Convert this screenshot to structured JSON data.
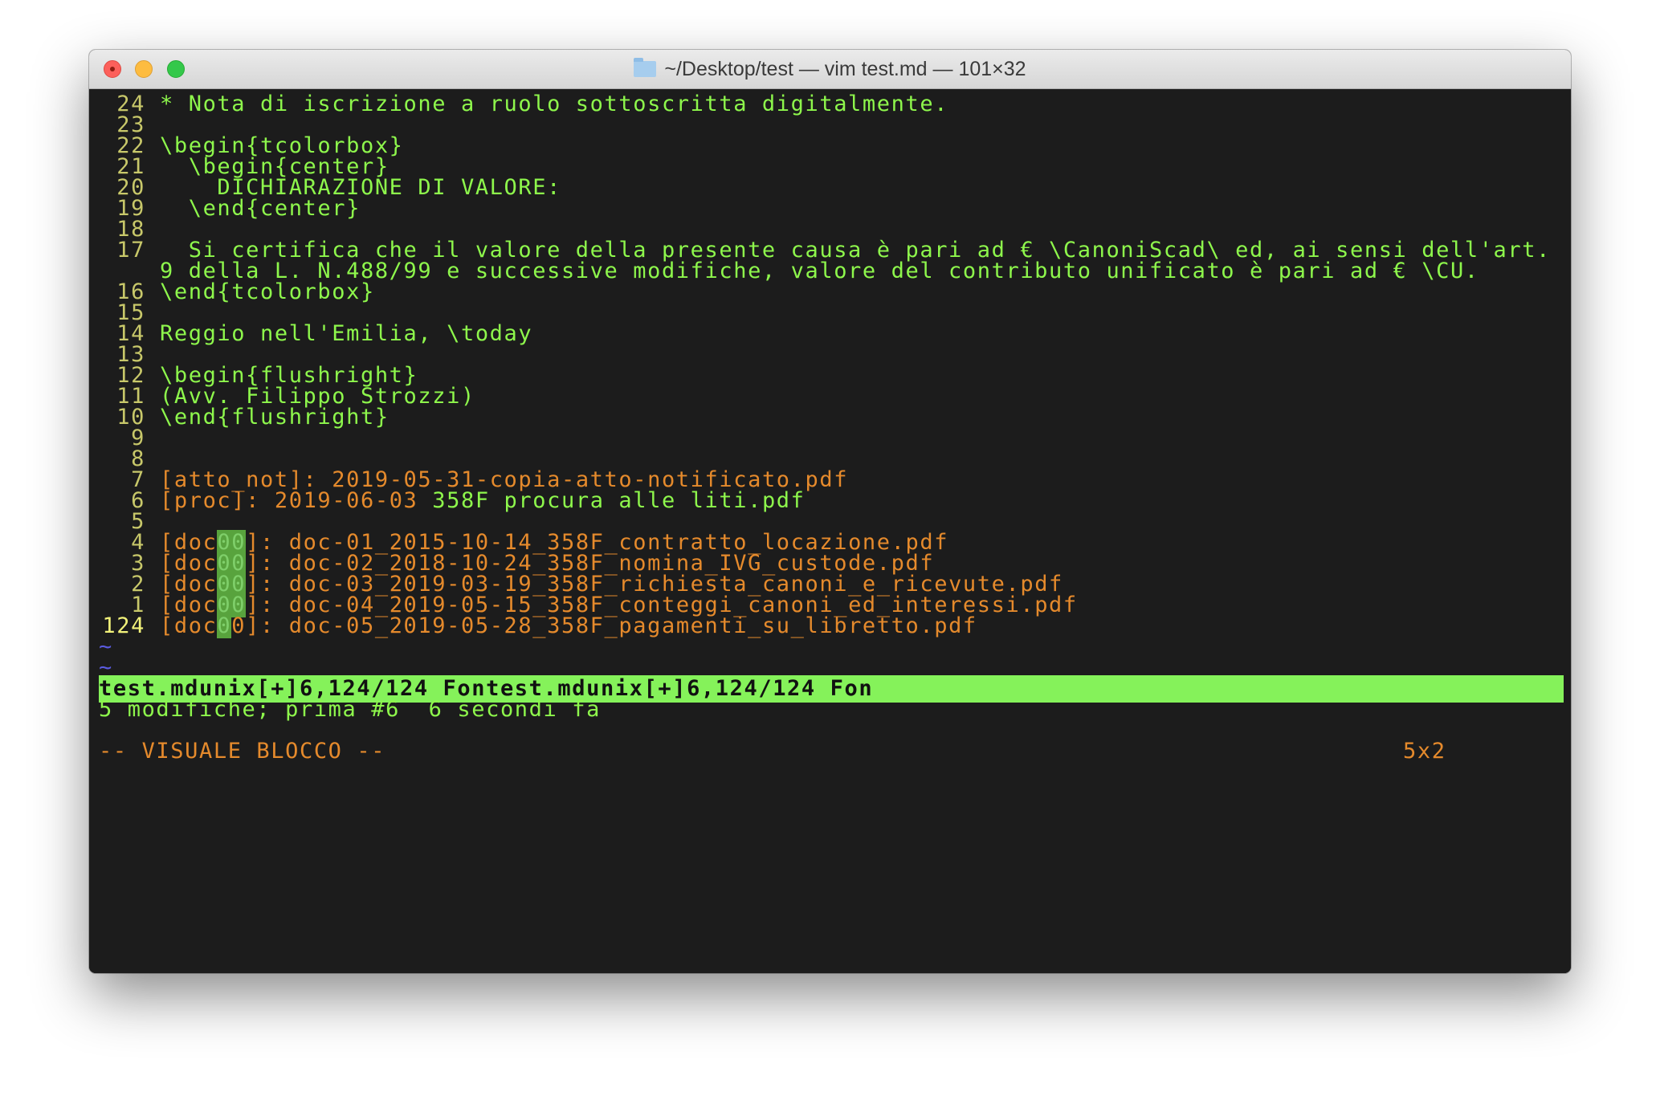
{
  "window": {
    "title": "~/Desktop/test — vim test.md — 101×32"
  },
  "editor": {
    "lines": {
      "l24": {
        "num": "24",
        "text": "* Nota di iscrizione a ruolo sottoscritta digitalmente."
      },
      "l23": {
        "num": "23"
      },
      "l22": {
        "num": "22",
        "text": "\\begin{tcolorbox}"
      },
      "l21": {
        "num": "21",
        "text": "  \\begin{center}"
      },
      "l20": {
        "num": "20",
        "text": "    DICHIARAZIONE DI VALORE:"
      },
      "l19": {
        "num": "19",
        "text": "  \\end{center}"
      },
      "l18": {
        "num": "18"
      },
      "l17": {
        "num": "17",
        "text": "  Si certifica che il valore della presente causa è pari ad € \\CanoniScad\\ ed, ai sensi dell'art."
      },
      "l17b": {
        "text": "9 della L. N.488/99 e successive modifiche, valore del contributo unificato è pari ad € \\CU."
      },
      "l16": {
        "num": "16",
        "text": "\\end{tcolorbox}"
      },
      "l15": {
        "num": "15"
      },
      "l14": {
        "num": "14",
        "text": "Reggio nell'Emilia, \\today"
      },
      "l13": {
        "num": "13"
      },
      "l12": {
        "num": "12",
        "text": "\\begin{flushright}"
      },
      "l11": {
        "num": "11",
        "text": "(Avv. Filippo Strozzi)"
      },
      "l10": {
        "num": "10",
        "text": "\\end{flushright}"
      },
      "l9": {
        "num": "9"
      },
      "l8": {
        "num": "8"
      },
      "l7": {
        "num": "7",
        "ref": "[atto_not]:",
        "value": "2019-05-31-copia-atto-notificato.pdf"
      },
      "l6": {
        "num": "6",
        "ref": "[proc]:",
        "date": "2019-06-03",
        "rest": "358F procura alle liti.pdf"
      },
      "l5": {
        "num": "5"
      },
      "l4": {
        "num": "4",
        "value": "doc-01_2015-10-14_358F_contratto_locazione.pdf"
      },
      "l3": {
        "num": "3",
        "value": "doc-02_2018-10-24_358F_nomina_IVG_custode.pdf"
      },
      "l2": {
        "num": "2",
        "value": "doc-03_2019-03-19_358F_richiesta_canoni_e_ricevute.pdf"
      },
      "l1": {
        "num": "1",
        "value": "doc-04_2019-05-15_358F_conteggi_canoni_ed_interessi.pdf"
      },
      "l124": {
        "num": "124",
        "value": "doc-05_2019-05-28_358F_pagamenti_su_libretto.pdf"
      }
    },
    "doc_ref": {
      "open": "[doc",
      "selected": "00",
      "cursor_selected": "0",
      "cursor_char": "0",
      "close": "]:"
    },
    "tilde": "~"
  },
  "statusline": {
    "text": "test.mdunix[+]6,124/124 Fontest.mdunix[+]6,124/124 Fon"
  },
  "message": {
    "text": "5 modifiche; prima #6  6 secondi fa"
  },
  "mode": {
    "label": "-- VISUALE BLOCCO --",
    "selection_size": "5x2"
  },
  "colors": {
    "background": "#1c1c1c",
    "text_green": "#8ef74c",
    "link_orange": "#e58a2c",
    "line_number": "#c8c86a",
    "statusline": "#85f25a",
    "visual_selection": "#58a33d",
    "tilde_blue": "#5b5be0"
  }
}
